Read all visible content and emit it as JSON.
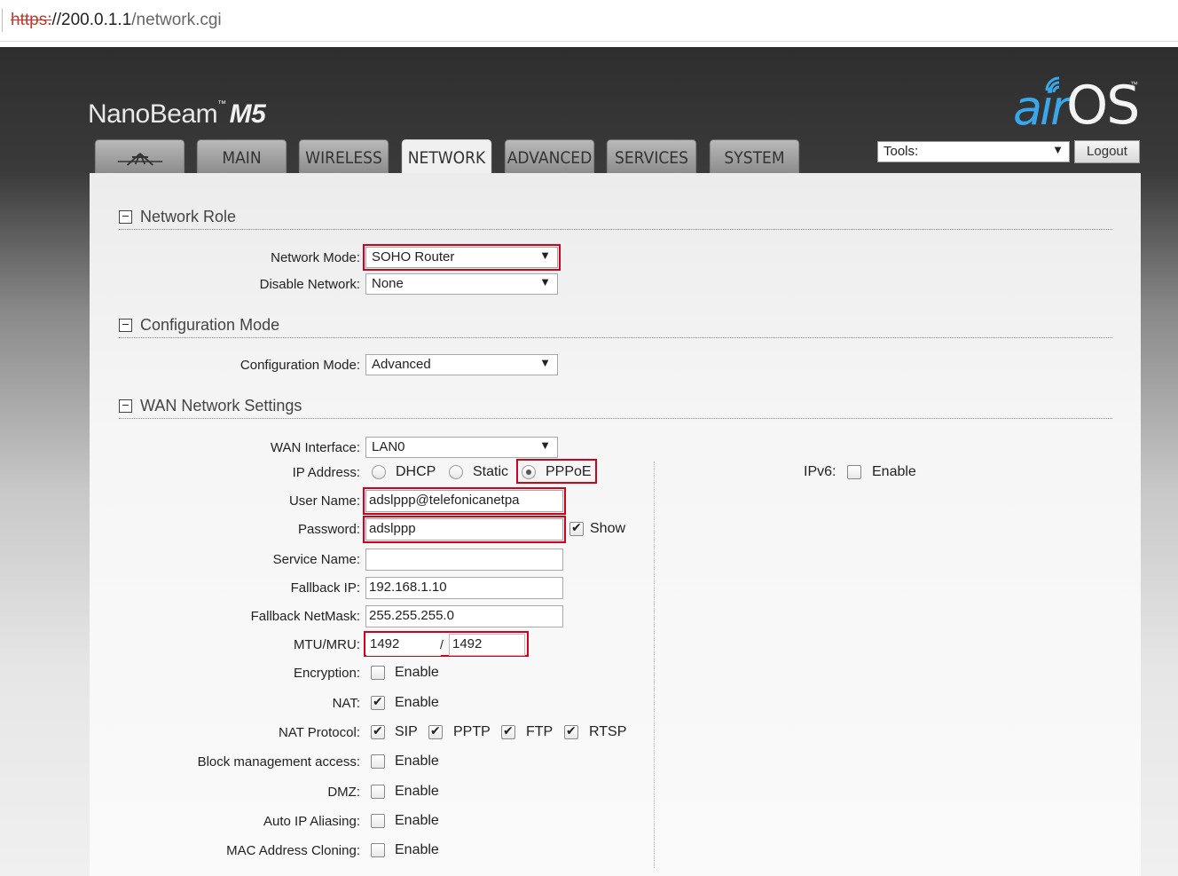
{
  "browser": {
    "url_scheme": "https:",
    "url_host": "//200.0.1.1",
    "url_path": "/network.cgi"
  },
  "brand": {
    "name": "NanoBeam",
    "tm": "™",
    "model": "M5"
  },
  "logo": {
    "air": "air",
    "os": "OS",
    "tm": "™",
    "accent": "#3aa7ea"
  },
  "tabs": [
    {
      "label": "",
      "icon": "ubiquiti-logo-icon"
    },
    {
      "label": "MAIN"
    },
    {
      "label": "WIRELESS"
    },
    {
      "label": "NETWORK"
    },
    {
      "label": "ADVANCED"
    },
    {
      "label": "SERVICES"
    },
    {
      "label": "SYSTEM"
    }
  ],
  "tools": {
    "value": "Tools:",
    "logout": "Logout"
  },
  "sections": {
    "network_role": "Network Role",
    "configuration_mode": "Configuration Mode",
    "wan_settings": "WAN Network Settings"
  },
  "fields": {
    "network_mode": {
      "label": "Network Mode:",
      "value": "SOHO Router"
    },
    "disable_network": {
      "label": "Disable Network:",
      "value": "None"
    },
    "configuration_mode": {
      "label": "Configuration Mode:",
      "value": "Advanced"
    },
    "wan_interface": {
      "label": "WAN Interface:",
      "value": "LAN0"
    },
    "ip_address": {
      "label": "IP Address:",
      "options": [
        "DHCP",
        "Static",
        "PPPoE"
      ],
      "selected": "PPPoE"
    },
    "ipv6": {
      "label": "IPv6:",
      "option": "Enable"
    },
    "user_name": {
      "label": "User Name:",
      "value": "adslppp@telefonicanetpa"
    },
    "password": {
      "label": "Password:",
      "value": "adslppp",
      "show_label": "Show"
    },
    "service_name": {
      "label": "Service Name:",
      "value": ""
    },
    "fallback_ip": {
      "label": "Fallback IP:",
      "value": "192.168.1.10"
    },
    "fallback_netmask": {
      "label": "Fallback NetMask:",
      "value": "255.255.255.0"
    },
    "mtu_mru": {
      "label": "MTU/MRU:",
      "mtu": "1492",
      "separator": "/",
      "mru": "1492"
    },
    "encryption": {
      "label": "Encryption:",
      "option": "Enable"
    },
    "nat": {
      "label": "NAT:",
      "option": "Enable"
    },
    "nat_protocol": {
      "label": "NAT Protocol:",
      "options": [
        "SIP",
        "PPTP",
        "FTP",
        "RTSP"
      ]
    },
    "block_mgmt": {
      "label": "Block management access:",
      "option": "Enable"
    },
    "dmz": {
      "label": "DMZ:",
      "option": "Enable"
    },
    "auto_ip_aliasing": {
      "label": "Auto IP Aliasing:",
      "option": "Enable"
    },
    "mac_cloning": {
      "label": "MAC Address Cloning:",
      "option": "Enable"
    }
  },
  "arrow": "▼",
  "toggle": "−"
}
